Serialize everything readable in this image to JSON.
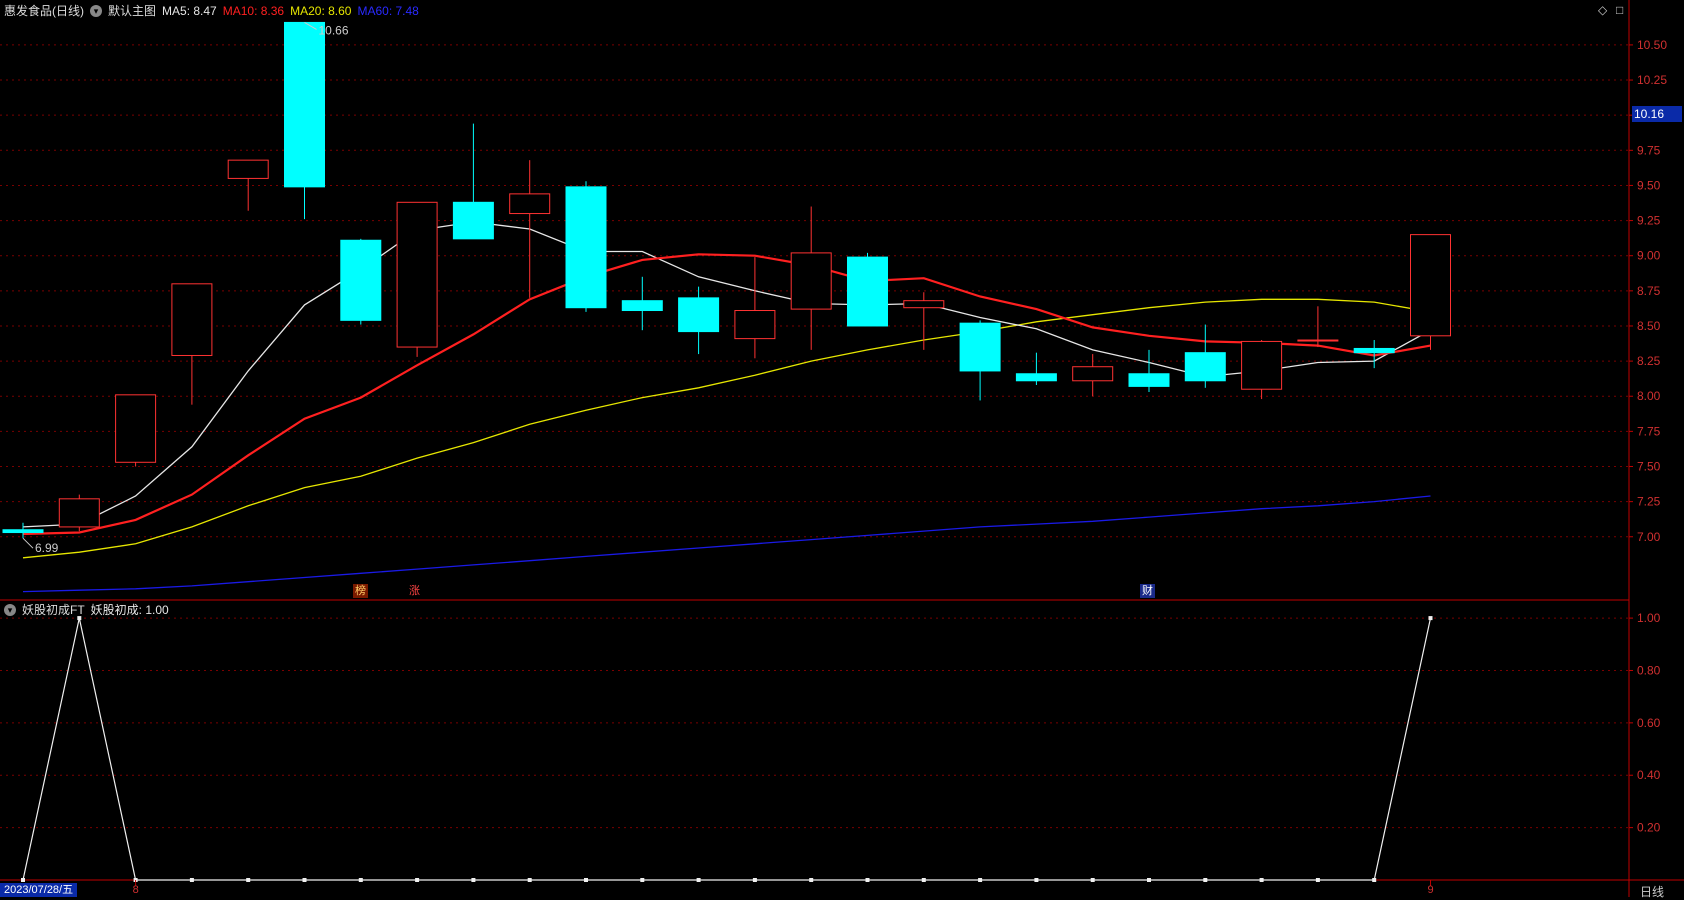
{
  "header": {
    "stock_name": "惠发食品(日线)",
    "template": "默认主图",
    "ma5_label": "MA5: 8.47",
    "ma10_label": "MA10: 8.36",
    "ma20_label": "MA20: 8.60",
    "ma60_label": "MA60: 7.48"
  },
  "indicator_header": {
    "name": "妖股初成FT",
    "value_label": "妖股初成: 1.00"
  },
  "controls": {
    "diamond": "◇",
    "maximize": "□"
  },
  "last_price_tag": "10.16",
  "date_label": "2023/07/28/五",
  "period_label": "日线",
  "month_labels": [
    "8",
    "9"
  ],
  "markers": [
    "榜",
    "涨",
    "财"
  ],
  "colors": {
    "up": "#ff3232",
    "down": "#00ffff",
    "ma5": "#e6e6e6",
    "ma10": "#ff2020",
    "ma20": "#e6e600",
    "ma60": "#1a1ae6",
    "grid": "#7a0000",
    "axis": "#c00000"
  },
  "chart_data": [
    {
      "type": "candlestick",
      "ylim": [
        6.55,
        10.72
      ],
      "yticks": [
        "10.50",
        "10.25",
        "10.00",
        "9.75",
        "9.50",
        "9.25",
        "9.00",
        "8.75",
        "8.50",
        "8.25",
        "8.00",
        "7.75",
        "7.50",
        "7.25",
        "7.00"
      ],
      "annotations": {
        "high": "10.66",
        "low": "6.99"
      },
      "candles": [
        {
          "o": 7.05,
          "h": 7.1,
          "l": 6.99,
          "c": 7.03
        },
        {
          "o": 7.07,
          "h": 7.3,
          "l": 7.04,
          "c": 7.27
        },
        {
          "o": 7.53,
          "h": 8.01,
          "l": 7.5,
          "c": 8.01
        },
        {
          "o": 8.29,
          "h": 8.8,
          "l": 7.94,
          "c": 8.8
        },
        {
          "o": 9.55,
          "h": 9.68,
          "l": 9.32,
          "c": 9.68
        },
        {
          "o": 10.66,
          "h": 10.66,
          "l": 9.26,
          "c": 9.49
        },
        {
          "o": 9.11,
          "h": 9.12,
          "l": 8.51,
          "c": 8.54
        },
        {
          "o": 8.35,
          "h": 9.38,
          "l": 8.28,
          "c": 9.38
        },
        {
          "o": 9.38,
          "h": 9.94,
          "l": 9.12,
          "c": 9.12
        },
        {
          "o": 9.3,
          "h": 9.68,
          "l": 8.7,
          "c": 9.44
        },
        {
          "o": 9.49,
          "h": 9.53,
          "l": 8.6,
          "c": 8.63
        },
        {
          "o": 8.68,
          "h": 8.85,
          "l": 8.47,
          "c": 8.61
        },
        {
          "o": 8.7,
          "h": 8.78,
          "l": 8.3,
          "c": 8.46
        },
        {
          "o": 8.41,
          "h": 8.99,
          "l": 8.27,
          "c": 8.61
        },
        {
          "o": 8.62,
          "h": 9.35,
          "l": 8.33,
          "c": 9.02
        },
        {
          "o": 8.99,
          "h": 9.02,
          "l": 8.5,
          "c": 8.5
        },
        {
          "o": 8.63,
          "h": 8.74,
          "l": 8.33,
          "c": 8.68
        },
        {
          "o": 8.52,
          "h": 8.54,
          "l": 7.97,
          "c": 8.18
        },
        {
          "o": 8.16,
          "h": 8.31,
          "l": 8.08,
          "c": 8.11
        },
        {
          "o": 8.11,
          "h": 8.3,
          "l": 8.0,
          "c": 8.21
        },
        {
          "o": 8.16,
          "h": 8.33,
          "l": 8.03,
          "c": 8.07
        },
        {
          "o": 8.31,
          "h": 8.51,
          "l": 8.06,
          "c": 8.11
        },
        {
          "o": 8.05,
          "h": 8.4,
          "l": 7.98,
          "c": 8.39
        },
        {
          "o": 8.4,
          "h": 8.64,
          "l": 8.35,
          "c": 8.4
        },
        {
          "o": 8.34,
          "h": 8.4,
          "l": 8.2,
          "c": 8.31
        },
        {
          "o": 8.43,
          "h": 9.15,
          "l": 8.33,
          "c": 9.15
        }
      ],
      "ma5": [
        7.07,
        7.09,
        7.29,
        7.64,
        8.18,
        8.65,
        8.9,
        9.18,
        9.24,
        9.19,
        9.03,
        9.03,
        8.85,
        8.75,
        8.66,
        8.65,
        8.66,
        8.56,
        8.48,
        8.33,
        8.24,
        8.14,
        8.18,
        8.24,
        8.25,
        8.47
      ],
      "ma10": [
        7.02,
        7.03,
        7.12,
        7.3,
        7.58,
        7.84,
        7.99,
        8.22,
        8.44,
        8.69,
        8.85,
        8.97,
        9.01,
        9.0,
        8.93,
        8.82,
        8.84,
        8.71,
        8.62,
        8.49,
        8.43,
        8.39,
        8.38,
        8.36,
        8.29,
        8.36
      ],
      "ma20": [
        6.85,
        6.89,
        6.95,
        7.07,
        7.22,
        7.35,
        7.43,
        7.56,
        7.67,
        7.8,
        7.9,
        7.99,
        8.06,
        8.15,
        8.25,
        8.33,
        8.4,
        8.46,
        8.53,
        8.58,
        8.63,
        8.67,
        8.69,
        8.69,
        8.67,
        8.6
      ],
      "ma60": [
        6.61,
        6.62,
        6.63,
        6.65,
        6.68,
        6.71,
        6.74,
        6.77,
        6.8,
        6.83,
        6.86,
        6.89,
        6.92,
        6.95,
        6.98,
        7.01,
        7.04,
        7.07,
        7.09,
        7.11,
        7.14,
        7.17,
        7.2,
        7.22,
        7.25,
        7.29
      ]
    },
    {
      "type": "line",
      "name": "妖股初成",
      "ylim": [
        0,
        1.05
      ],
      "yticks": [
        "1.00",
        "0.80",
        "0.60",
        "0.40",
        "0.20"
      ],
      "values": [
        0,
        1,
        0,
        0,
        0,
        0,
        0,
        0,
        0,
        0,
        0,
        0,
        0,
        0,
        0,
        0,
        0,
        0,
        0,
        0,
        0,
        0,
        0,
        0,
        0,
        1
      ]
    }
  ]
}
